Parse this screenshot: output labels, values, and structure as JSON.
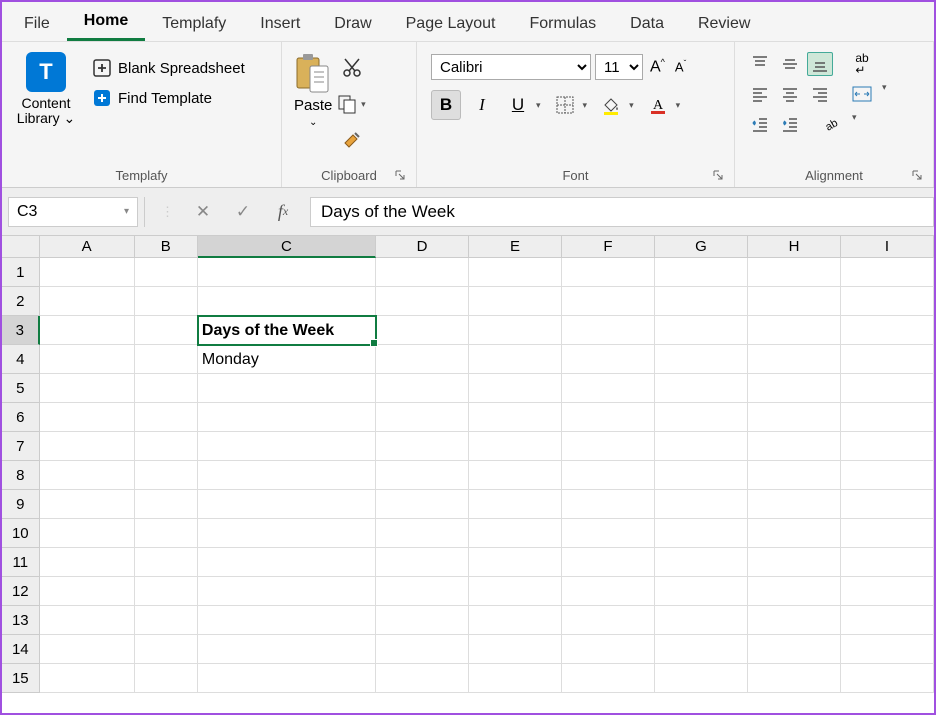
{
  "tabs": [
    "File",
    "Home",
    "Templafy",
    "Insert",
    "Draw",
    "Page Layout",
    "Formulas",
    "Data",
    "Review"
  ],
  "active_tab": "Home",
  "templafy": {
    "content_library": "Content Library ⌄",
    "blank_spreadsheet": "Blank Spreadsheet",
    "find_template": "Find Template",
    "group_label": "Templafy"
  },
  "clipboard": {
    "paste": "Paste",
    "group_label": "Clipboard"
  },
  "font": {
    "name": "Calibri",
    "size": "11",
    "group_label": "Font"
  },
  "alignment": {
    "group_label": "Alignment"
  },
  "namebox": "C3",
  "formula_value": "Days of the Week",
  "columns": [
    "A",
    "B",
    "C",
    "D",
    "E",
    "F",
    "G",
    "H",
    "I"
  ],
  "selected_col": "C",
  "rows": 15,
  "selected_row": 3,
  "cells": {
    "C3": {
      "value": "Days of the Week",
      "bold": true,
      "active": true
    },
    "C4": {
      "value": "Monday"
    }
  }
}
